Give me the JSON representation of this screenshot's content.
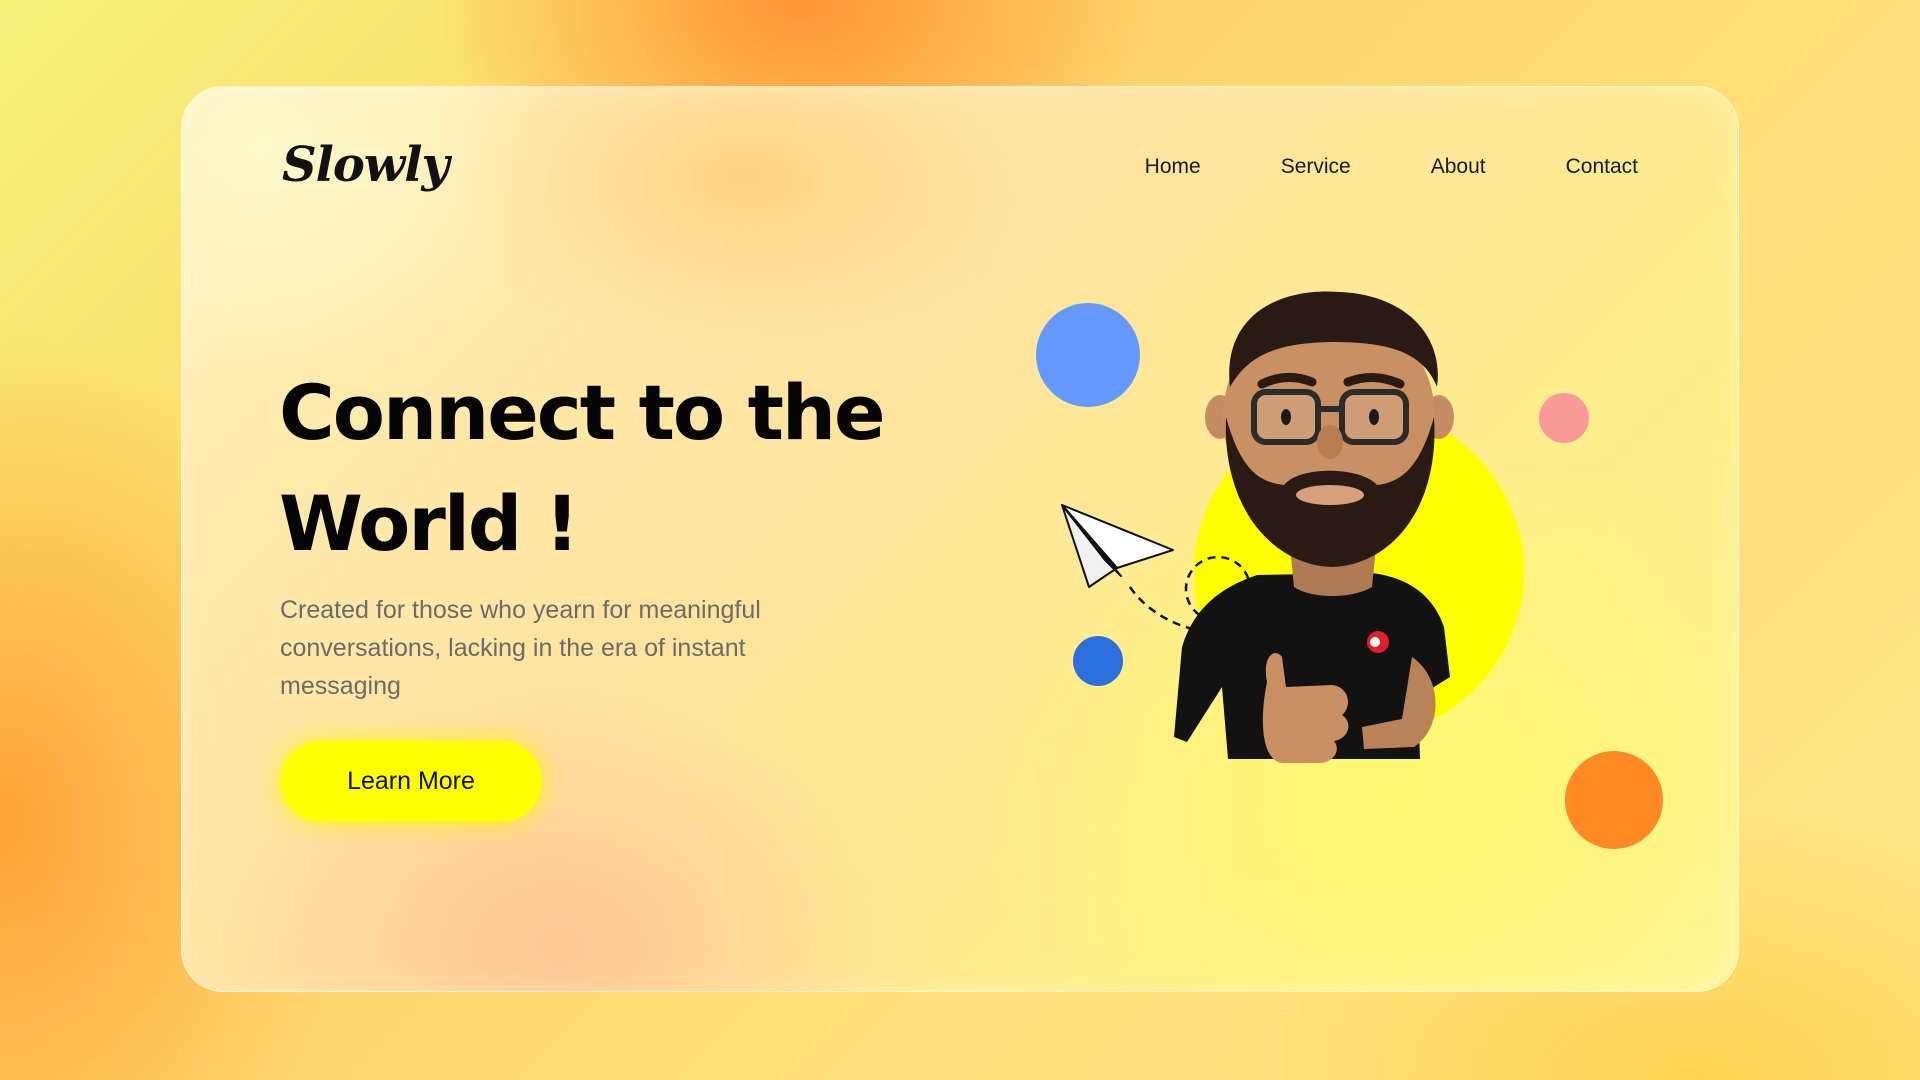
{
  "logo": {
    "text": "Slowly"
  },
  "nav": {
    "home": "Home",
    "service": "Service",
    "about": "About",
    "contact": "Contact"
  },
  "hero": {
    "title_line1": "Connect to the",
    "title_line2": "World !",
    "description": "Created for those who yearn for meaningful conversations, lacking in the era of instant messaging",
    "cta_label": "Learn More"
  },
  "colors": {
    "accent_yellow": "#ffff00",
    "blue_light": "#6699ff",
    "blue_dark": "#2a6fdb",
    "pink": "#f99a98",
    "orange": "#ff8a24"
  },
  "illustration": {
    "icons": [
      "paper-plane-icon",
      "avatar-3d-man-thumbs-up"
    ]
  }
}
